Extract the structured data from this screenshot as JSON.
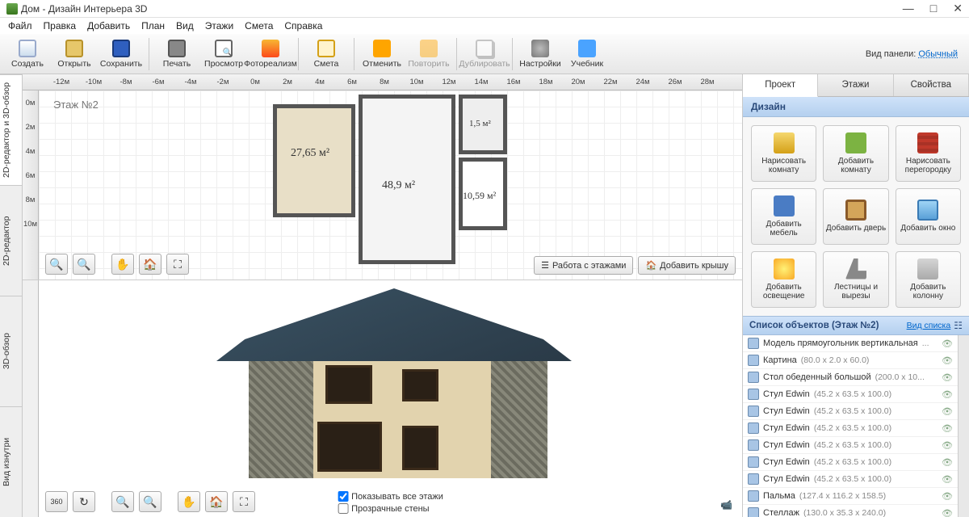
{
  "title": "Дом - Дизайн Интерьера 3D",
  "win": {
    "min": "—",
    "max": "□",
    "close": "✕"
  },
  "menu": [
    "Файл",
    "Правка",
    "Добавить",
    "План",
    "Вид",
    "Этажи",
    "Смета",
    "Справка"
  ],
  "toolbar": {
    "panel_label": "Вид панели:",
    "panel_mode": "Обычный",
    "items": [
      {
        "k": "new",
        "label": "Создать",
        "ico": "ico-new"
      },
      {
        "k": "open",
        "label": "Открыть",
        "ico": "ico-open"
      },
      {
        "k": "save",
        "label": "Сохранить",
        "ico": "ico-save"
      },
      {
        "k": "sep"
      },
      {
        "k": "print",
        "label": "Печать",
        "ico": "ico-print"
      },
      {
        "k": "preview",
        "label": "Просмотр",
        "ico": "ico-preview"
      },
      {
        "k": "photo",
        "label": "Фотореализм",
        "ico": "ico-photo"
      },
      {
        "k": "sep"
      },
      {
        "k": "smeta",
        "label": "Смета",
        "ico": "ico-smeta"
      },
      {
        "k": "sep"
      },
      {
        "k": "undo",
        "label": "Отменить",
        "ico": "ico-undo"
      },
      {
        "k": "redo",
        "label": "Повторить",
        "ico": "ico-redo",
        "disabled": true
      },
      {
        "k": "sep"
      },
      {
        "k": "dup",
        "label": "Дублировать",
        "ico": "ico-dup",
        "disabled": true
      },
      {
        "k": "sep"
      },
      {
        "k": "settings",
        "label": "Настройки",
        "ico": "ico-settings"
      },
      {
        "k": "tutorial",
        "label": "Учебник",
        "ico": "ico-tutorial"
      }
    ]
  },
  "ruler_h": [
    "-12м",
    "-10м",
    "-8м",
    "-6м",
    "-4м",
    "-2м",
    "0м",
    "2м",
    "4м",
    "6м",
    "8м",
    "10м",
    "12м",
    "14м",
    "16м",
    "18м",
    "20м",
    "22м",
    "24м",
    "26м",
    "28м"
  ],
  "ruler_v": [
    "0м",
    "2м",
    "4м",
    "6м",
    "8м",
    "10м"
  ],
  "vtabs": [
    "2D-редактор и 3D-обзор",
    "2D-редактор",
    "3D-обзор",
    "Вид изнутри"
  ],
  "floor_label": "Этаж №2",
  "rooms": {
    "r1": "27,65 м²",
    "r2": "48,9 м²",
    "r3": "1,5 м²",
    "r4": "10,59 м²"
  },
  "overlay": {
    "floors": "Работа с этажами",
    "addroof": "Добавить крышу"
  },
  "opts": {
    "show_all": "Показывать все этажи",
    "transparent": "Прозрачные стены"
  },
  "side": {
    "tabs": [
      "Проект",
      "Этажи",
      "Свойства"
    ],
    "design_title": "Дизайн",
    "cards": [
      {
        "t": "Нарисовать комнату",
        "i": "di1"
      },
      {
        "t": "Добавить комнату",
        "i": "di2"
      },
      {
        "t": "Нарисовать перегородку",
        "i": "di3"
      },
      {
        "t": "Добавить мебель",
        "i": "di4"
      },
      {
        "t": "Добавить дверь",
        "i": "di5"
      },
      {
        "t": "Добавить окно",
        "i": "di6"
      },
      {
        "t": "Добавить освещение",
        "i": "di7"
      },
      {
        "t": "Лестницы и вырезы",
        "i": "di8"
      },
      {
        "t": "Добавить колонну",
        "i": "di9"
      }
    ],
    "objlist_title": "Список объектов (Этаж №2)",
    "view_list": "Вид списка",
    "objects": [
      {
        "n": "Модель прямоугольник вертикальная",
        "d": "..."
      },
      {
        "n": "Картина",
        "d": "(80.0 x 2.0 x 60.0)"
      },
      {
        "n": "Стол обеденный большой",
        "d": "(200.0 x 10..."
      },
      {
        "n": "Стул Edwin",
        "d": "(45.2 x 63.5 x 100.0)"
      },
      {
        "n": "Стул Edwin",
        "d": "(45.2 x 63.5 x 100.0)"
      },
      {
        "n": "Стул Edwin",
        "d": "(45.2 x 63.5 x 100.0)"
      },
      {
        "n": "Стул Edwin",
        "d": "(45.2 x 63.5 x 100.0)"
      },
      {
        "n": "Стул Edwin",
        "d": "(45.2 x 63.5 x 100.0)"
      },
      {
        "n": "Стул Edwin",
        "d": "(45.2 x 63.5 x 100.0)"
      },
      {
        "n": "Пальма",
        "d": "(127.4 x 116.2 x 158.5)"
      },
      {
        "n": "Стеллаж",
        "d": "(130.0 x 35.3 x 240.0)"
      }
    ]
  }
}
